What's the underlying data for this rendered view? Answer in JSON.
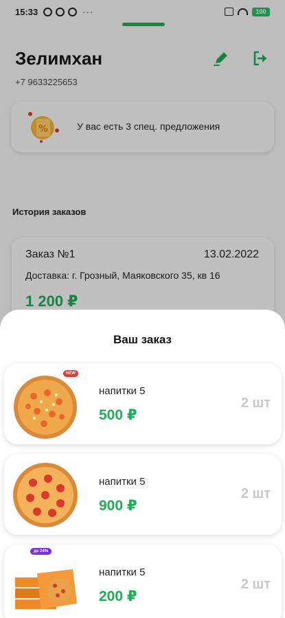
{
  "status_bar": {
    "time": "15:33",
    "dots": "···",
    "battery": "100"
  },
  "profile": {
    "name": "Зелимхан",
    "phone": "+7 9633225653"
  },
  "promo": {
    "text": "У вас есть 3 спец. предложения"
  },
  "history": {
    "title": "История заказов",
    "orders": [
      {
        "number": "Заказ №1",
        "date": "13.02.2022",
        "address": "Доставка: г. Грозный, Маяковского 35, кв 16",
        "price": "1 200 ₽"
      }
    ]
  },
  "sheet": {
    "title": "Ваш заказ",
    "items": [
      {
        "name": "напитки 5",
        "price": "500 ₽",
        "qty": "2 шт",
        "badge": "NEW"
      },
      {
        "name": "напитки 5",
        "price": "900 ₽",
        "qty": "2 шт"
      },
      {
        "name": "напитки 5",
        "price": "200 ₽",
        "qty": "2 шт",
        "badge": "до 24%"
      }
    ]
  },
  "colors": {
    "accent": "#1fae55",
    "qty_gray": "#c7c7c7",
    "badge_new": "#e53935",
    "badge_discount": "#7b2ee3"
  }
}
